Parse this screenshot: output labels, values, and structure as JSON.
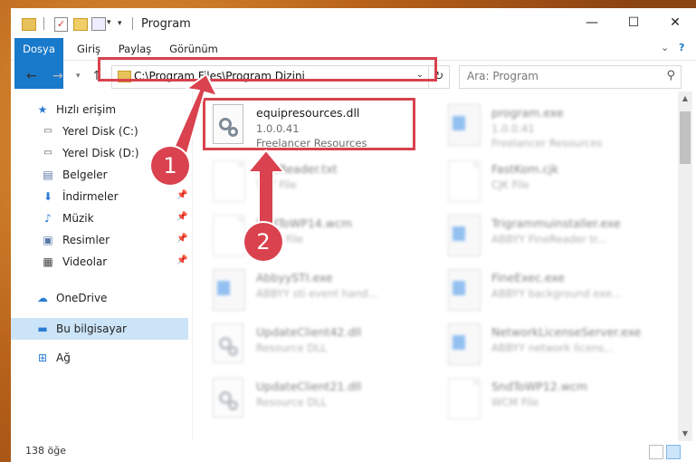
{
  "window": {
    "title": "Program",
    "controls": {
      "minimize": "—",
      "maximize": "☐",
      "close": "✕"
    }
  },
  "ribbon": {
    "tabs": [
      "Dosya",
      "Giriş",
      "Paylaş",
      "Görünüm"
    ],
    "expand": "⌄",
    "help": "?"
  },
  "address": {
    "path": "C:\\Program Files\\Program Dizini",
    "search_placeholder": "Ara: Program"
  },
  "sidebar": {
    "items": [
      {
        "label": "Hızlı erişim",
        "icon": "star-icon",
        "color": "#2b7cd3"
      },
      {
        "label": "Yerel Disk (C:)",
        "icon": "drive-icon",
        "pinned": false
      },
      {
        "label": "Yerel Disk (D:)",
        "icon": "drive-icon",
        "pinned": false
      },
      {
        "label": "Belgeler",
        "icon": "documents-icon",
        "pinned": false
      },
      {
        "label": "İndirmeler",
        "icon": "download-icon",
        "pinned": true
      },
      {
        "label": "Müzik",
        "icon": "music-icon",
        "pinned": true
      },
      {
        "label": "Resimler",
        "icon": "pictures-icon",
        "pinned": true
      },
      {
        "label": "Videolar",
        "icon": "videos-icon",
        "pinned": true
      },
      {
        "label": "OneDrive",
        "icon": "cloud-icon"
      },
      {
        "label": "Bu bilgisayar",
        "icon": "computer-icon",
        "selected": true
      },
      {
        "label": "Ağ",
        "icon": "network-icon"
      }
    ]
  },
  "files": {
    "highlighted": {
      "name": "equipresources.dll",
      "version": "1.0.0.41",
      "company": "Freelancer Resources"
    },
    "others": [
      {
        "name": "program.exe",
        "l2": "1.0.0.41",
        "l3": "Freelancer Resources"
      },
      {
        "name": "FineReader.txt",
        "l2": "TXT File",
        "l3": ""
      },
      {
        "name": "FastKom.cjk",
        "l2": "CJK File",
        "l3": ""
      },
      {
        "name": "SndToWP14.wcm",
        "l2": "WCM File",
        "l3": ""
      },
      {
        "name": "Trigrammuinstaller.exe",
        "l2": "ABBYY FineReader tr...",
        "l3": ""
      },
      {
        "name": "AbbyySTI.exe",
        "l2": "ABBYY sti event hand...",
        "l3": ""
      },
      {
        "name": "FineExec.exe",
        "l2": "ABBYY background exe...",
        "l3": ""
      },
      {
        "name": "UpdateClient42.dll",
        "l2": "Resource DLL",
        "l3": ""
      },
      {
        "name": "NetworkLicenseServer.exe",
        "l2": "ABBYY network licens...",
        "l3": ""
      },
      {
        "name": "UpdateClient21.dll",
        "l2": "Resource DLL",
        "l3": ""
      },
      {
        "name": "SndToWP12.wcm",
        "l2": "WCM File",
        "l3": ""
      }
    ]
  },
  "annotations": {
    "step1": "1",
    "step2": "2",
    "color": "#d9424e"
  },
  "status": {
    "count": "138 öğe"
  }
}
